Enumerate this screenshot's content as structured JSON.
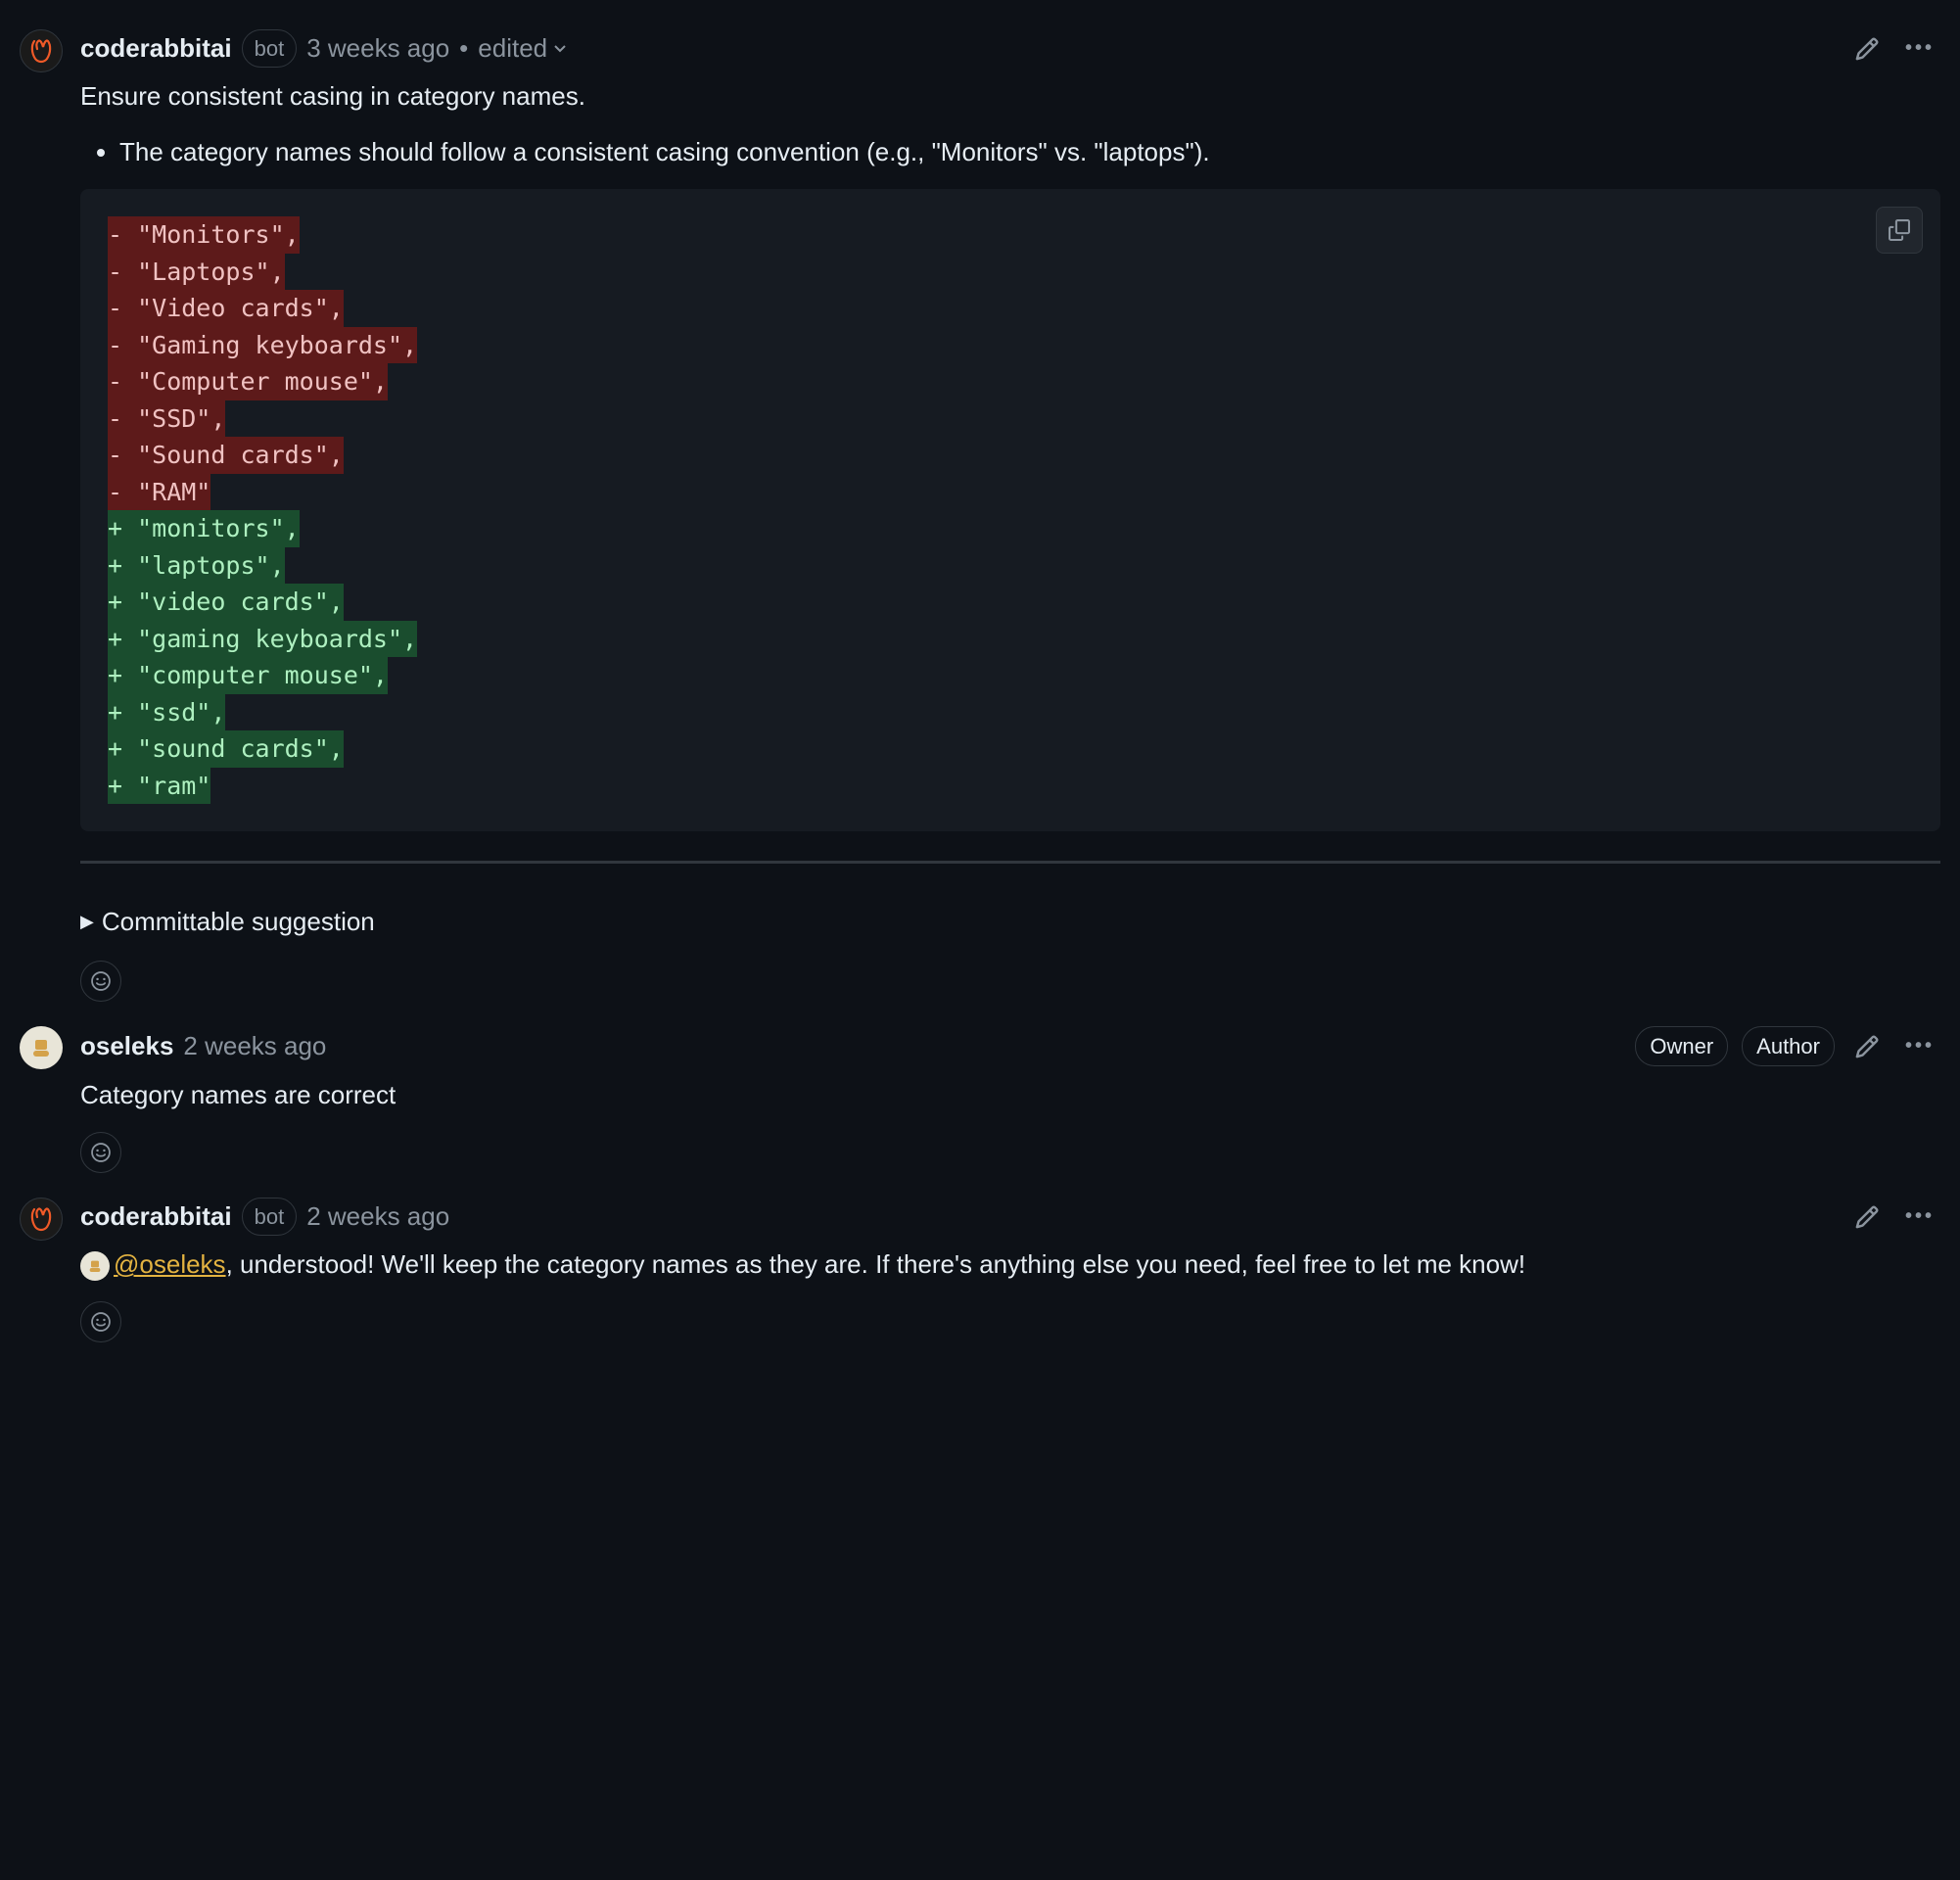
{
  "comments": [
    {
      "author": "coderabbitai",
      "badge": "bot",
      "timestamp": "3 weeks ago",
      "edited_label": "edited",
      "title": "Ensure consistent casing in category names.",
      "bullet": "The category names should follow a consistent casing convention (e.g., \"Monitors\" vs. \"laptops\").",
      "diff": {
        "del": [
          "- \"Monitors\",",
          "- \"Laptops\",",
          "- \"Video cards\",",
          "- \"Gaming keyboards\",",
          "- \"Computer mouse\",",
          "- \"SSD\",",
          "- \"Sound cards\",",
          "- \"RAM\""
        ],
        "add": [
          "+ \"monitors\",",
          "+ \"laptops\",",
          "+ \"video cards\",",
          "+ \"gaming keyboards\",",
          "+ \"computer mouse\",",
          "+ \"ssd\",",
          "+ \"sound cards\",",
          "+ \"ram\""
        ]
      },
      "details_label": "Committable suggestion"
    },
    {
      "author": "oseleks",
      "timestamp": "2 weeks ago",
      "roles": [
        "Owner",
        "Author"
      ],
      "text": "Category names are correct"
    },
    {
      "author": "coderabbitai",
      "badge": "bot",
      "timestamp": "2 weeks ago",
      "mention": "@oseleks",
      "text_after_mention": ", understood! We'll keep the category names as they are. If there's anything else you need, feel free to let me know!"
    }
  ]
}
